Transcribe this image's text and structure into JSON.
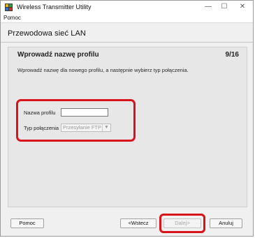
{
  "window": {
    "title": "Wireless Transmitter Utility",
    "controls": {
      "minimize": "—",
      "maximize": "☐",
      "close": "✕"
    }
  },
  "menubar": {
    "items": [
      {
        "label": "Pomoc"
      }
    ]
  },
  "page": {
    "section_title": "Przewodowa sieć LAN",
    "step_title": "Wprowadź nazwę profilu",
    "step_counter": "9/16",
    "description": "Wprowadź nazwę dla nowego profilu, a następnie wybierz typ połączenia."
  },
  "form": {
    "profile_name_label": "Nazwa profilu",
    "profile_name_value": "",
    "connection_type_label": "Typ połączenia",
    "connection_type_value": "Przesyłanie FTP"
  },
  "buttons": {
    "help": "Pomoc",
    "back": "<Wstecz",
    "next": "Dalej>",
    "cancel": "Anuluj"
  },
  "colors": {
    "highlight": "#d9131c"
  },
  "icons": {
    "app": "wireless-transmitter-app-icon",
    "dropdown": "chevron-down-icon"
  }
}
